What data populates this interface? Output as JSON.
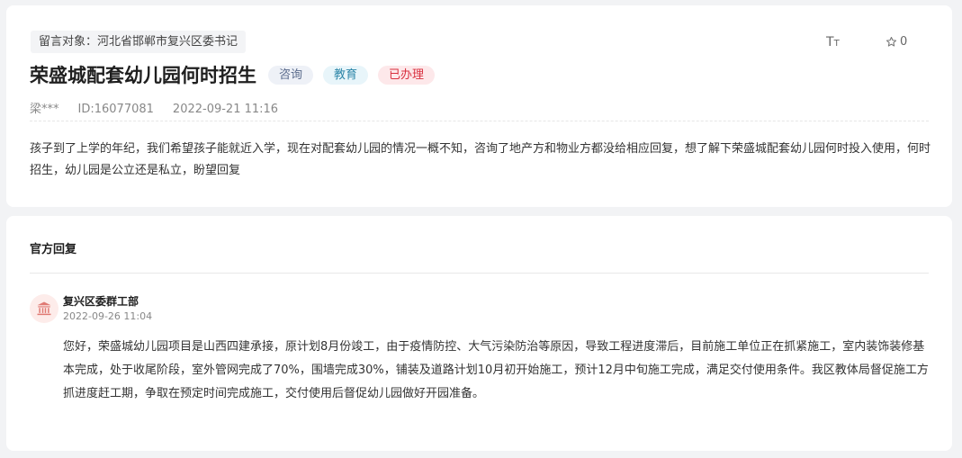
{
  "message": {
    "target": "留言对象：河北省邯郸市复兴区委书记",
    "title": "荣盛城配套幼儿园何时招生",
    "tags": {
      "type": "咨询",
      "category": "教育",
      "status": "已办理"
    },
    "author": "梁***",
    "id": "ID:16077081",
    "datetime": "2022-09-21 11:16",
    "content": "孩子到了上学的年纪，我们希望孩子能就近入学，现在对配套幼儿园的情况一概不知，咨询了地产方和物业方都没给相应回复，想了解下荣盛城配套幼儿园何时投入使用，何时招生，幼儿园是公立还是私立，盼望回复"
  },
  "toolbar": {
    "font_size_icon": "font-size-icon",
    "favorite_icon": "star-outline-icon",
    "favorite_count": "0"
  },
  "reply": {
    "section_title": "官方回复",
    "department": "复兴区委群工部",
    "datetime": "2022-09-26 11:04",
    "avatar_icon": "government-building-icon",
    "content": "您好，荣盛城幼儿园项目是山西四建承接，原计划8月份竣工，由于疫情防控、大气污染防治等原因，导致工程进度滞后，目前施工单位正在抓紧施工，室内装饰装修基本完成，处于收尾阶段，室外管网完成了70%，围墙完成30%，铺装及道路计划10月初开始施工，预计12月中旬施工完成，满足交付使用条件。我区教体局督促施工方抓进度赶工期，争取在预定时间完成施工，交付使用后督促幼儿园做好开园准备。"
  },
  "colors": {
    "page_bg": "#f2f3f5",
    "status_done": "#d9303f",
    "category_edu": "#2d86a8",
    "avatar_bg": "#fdecea",
    "avatar_icon": "#e07a74"
  }
}
